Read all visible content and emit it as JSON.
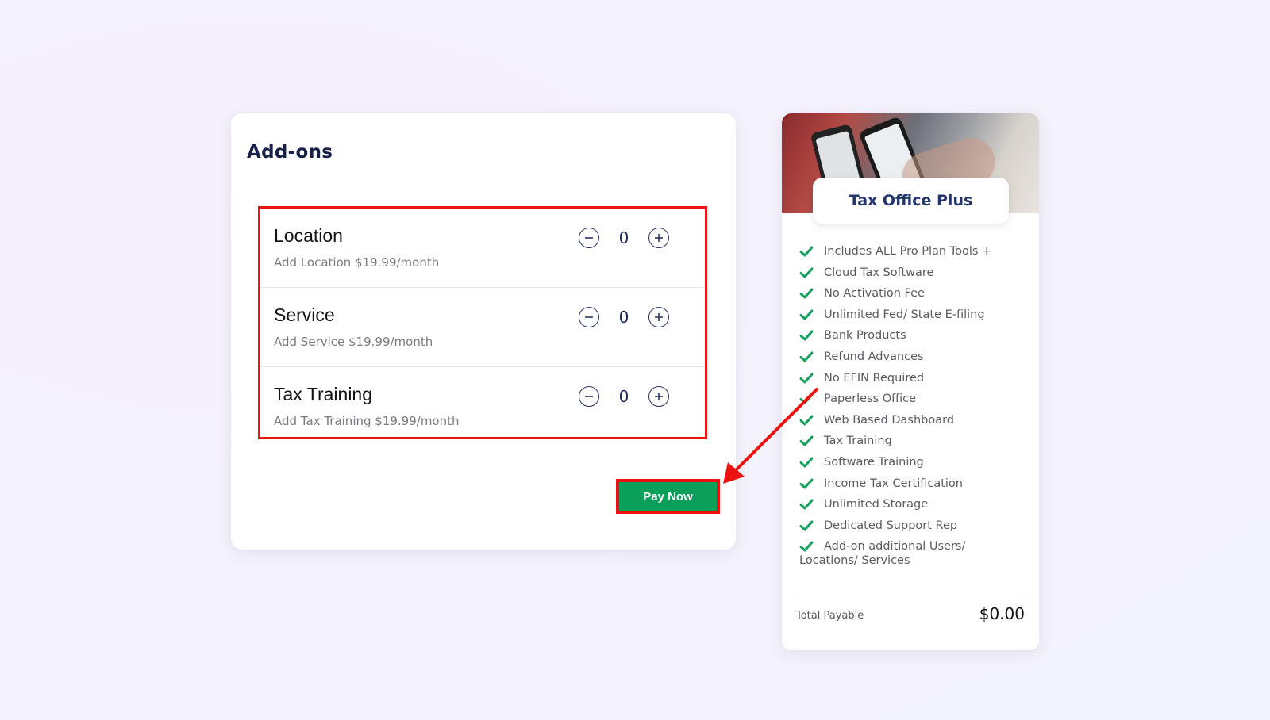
{
  "addons": {
    "title": "Add-ons",
    "items": [
      {
        "name": "Location",
        "description": "Add Location $19.99/month",
        "quantity": "0"
      },
      {
        "name": "Service",
        "description": "Add Service $19.99/month",
        "quantity": "0"
      },
      {
        "name": "Tax Training",
        "description": "Add Tax Training $19.99/month",
        "quantity": "0"
      }
    ],
    "pay_label": "Pay Now"
  },
  "plan": {
    "title": "Tax Office Plus",
    "features": [
      "Includes ALL Pro Plan Tools +",
      "Cloud Tax Software",
      "No Activation Fee",
      "Unlimited Fed/ State E-filing",
      "Bank Products",
      "Refund Advances",
      "No EFIN Required",
      "Paperless Office",
      "Web Based Dashboard",
      "Tax Training",
      "Software Training",
      "Income Tax Certification",
      "Unlimited Storage",
      "Dedicated Support Rep"
    ],
    "last_feature_line1": "Add-on additional Users/",
    "last_feature_line2": "Locations/ Services",
    "total_label": "Total Payable",
    "total_value": "$0.00"
  },
  "colors": {
    "highlight": "#ee1111",
    "pay_button": "#0aa05a",
    "check": "#12a05c",
    "title_navy": "#16204a"
  },
  "icons": {
    "minus": "minus-circle-icon",
    "plus": "plus-circle-icon",
    "check": "check-icon",
    "annotation": "red-arrow-icon"
  }
}
